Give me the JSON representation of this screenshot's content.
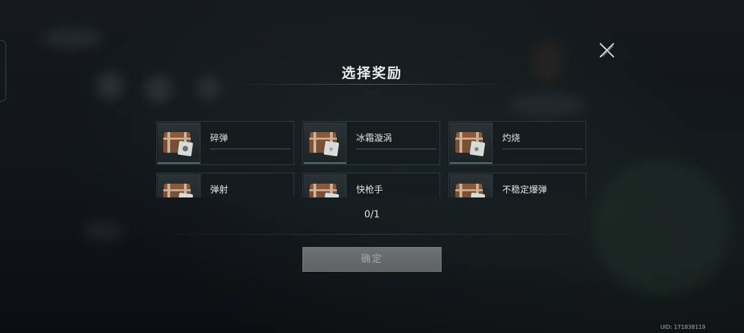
{
  "dialog": {
    "title": "选择奖励",
    "counter": "0/1",
    "confirm_label": "确定"
  },
  "rewards": [
    {
      "name": "碎弹",
      "icon": "chest-icon"
    },
    {
      "name": "冰霜漩涡",
      "icon": "chest-icon"
    },
    {
      "name": "灼烧",
      "icon": "chest-icon"
    },
    {
      "name": "弹射",
      "icon": "chest-icon"
    },
    {
      "name": "快枪手",
      "icon": "chest-icon"
    },
    {
      "name": "不稳定爆弹",
      "icon": "chest-icon"
    }
  ],
  "footer": {
    "uid": "UID: 171838119"
  },
  "colors": {
    "accent_border": "#5d7687",
    "button_disabled": "#6d7272"
  }
}
